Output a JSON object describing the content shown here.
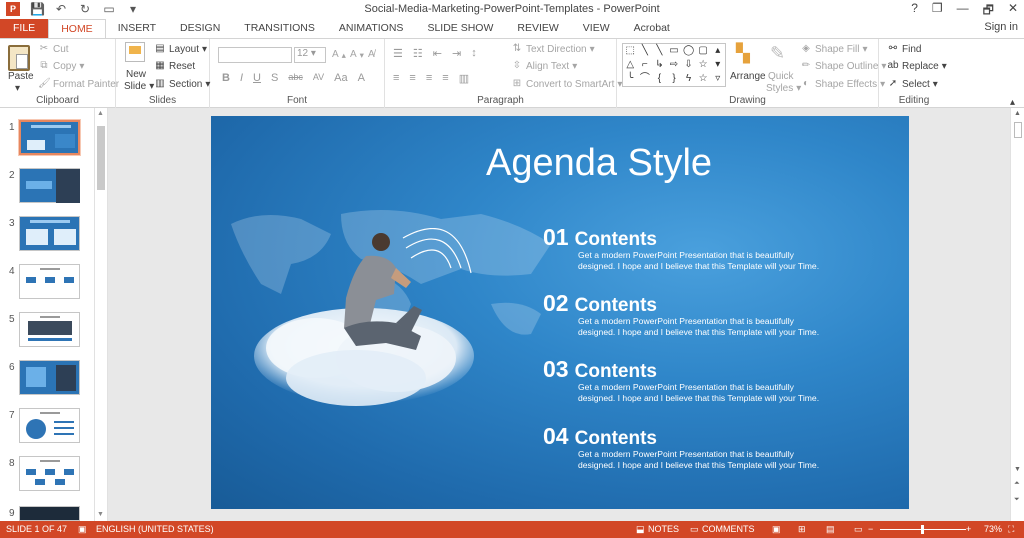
{
  "window": {
    "title": "Social-Media-Marketing-PowerPoint-Templates - PowerPoint",
    "controls": [
      "?",
      "❐",
      "—",
      "🗗",
      "✕"
    ]
  },
  "qat": {
    "icons": [
      "powerpoint-logo-icon",
      "save-icon",
      "undo-icon",
      "redo-icon",
      "present-icon",
      "customize-icon"
    ]
  },
  "tabs": [
    "FILE",
    "HOME",
    "INSERT",
    "DESIGN",
    "TRANSITIONS",
    "ANIMATIONS",
    "SLIDE SHOW",
    "REVIEW",
    "VIEW",
    "Acrobat"
  ],
  "signin": "Sign in",
  "ribbon": {
    "clipboard": {
      "label": "Clipboard",
      "paste": "Paste",
      "cut": "Cut",
      "copy": "Copy",
      "format_painter": "Format Painter"
    },
    "slides": {
      "label": "Slides",
      "new_slide": "New",
      "new_slide2": "Slide",
      "layout": "Layout",
      "reset": "Reset",
      "section": "Section"
    },
    "font": {
      "label": "Font",
      "size": "12",
      "row": [
        "B",
        "I",
        "U",
        "S",
        "abc",
        "AV",
        "Aa",
        "A"
      ]
    },
    "paragraph": {
      "label": "Paragraph",
      "text_direction": "Text Direction",
      "align_text": "Align Text",
      "smartart": "Convert to SmartArt"
    },
    "drawing": {
      "label": "Drawing",
      "arrange": "Arrange",
      "quick_styles": "Quick",
      "quick_styles2": "Styles",
      "shape_fill": "Shape Fill",
      "shape_outline": "Shape Outline",
      "shape_effects": "Shape Effects"
    },
    "editing": {
      "label": "Editing",
      "find": "Find",
      "replace": "Replace",
      "select": "Select"
    }
  },
  "thumbnails": [
    "1",
    "2",
    "3",
    "4",
    "5",
    "6",
    "7",
    "8",
    "9"
  ],
  "slide": {
    "title": "Agenda Style",
    "items": [
      {
        "num": "01",
        "heading": "Contents",
        "desc1": "Get a modern PowerPoint  Presentation that is beautifully",
        "desc2": "designed. I hope and I believe that this Template will your Time."
      },
      {
        "num": "02",
        "heading": "Contents",
        "desc1": "Get a modern PowerPoint  Presentation that is beautifully",
        "desc2": "designed. I hope and I believe that this Template will your Time."
      },
      {
        "num": "03",
        "heading": "Contents",
        "desc1": "Get a modern PowerPoint  Presentation that is beautifully",
        "desc2": "designed. I hope and I believe that this Template will your Time."
      },
      {
        "num": "04",
        "heading": "Contents",
        "desc1": "Get a modern PowerPoint  Presentation that is beautifully",
        "desc2": "designed. I hope and I believe that this Template will your Time."
      }
    ]
  },
  "status": {
    "slide_of": "SLIDE 1 OF 47",
    "language": "ENGLISH (UNITED STATES)",
    "notes": "NOTES",
    "comments": "COMMENTS",
    "zoom": "73%"
  },
  "colors": {
    "accent": "#d24726",
    "slide_bg": "#2f86c9"
  }
}
